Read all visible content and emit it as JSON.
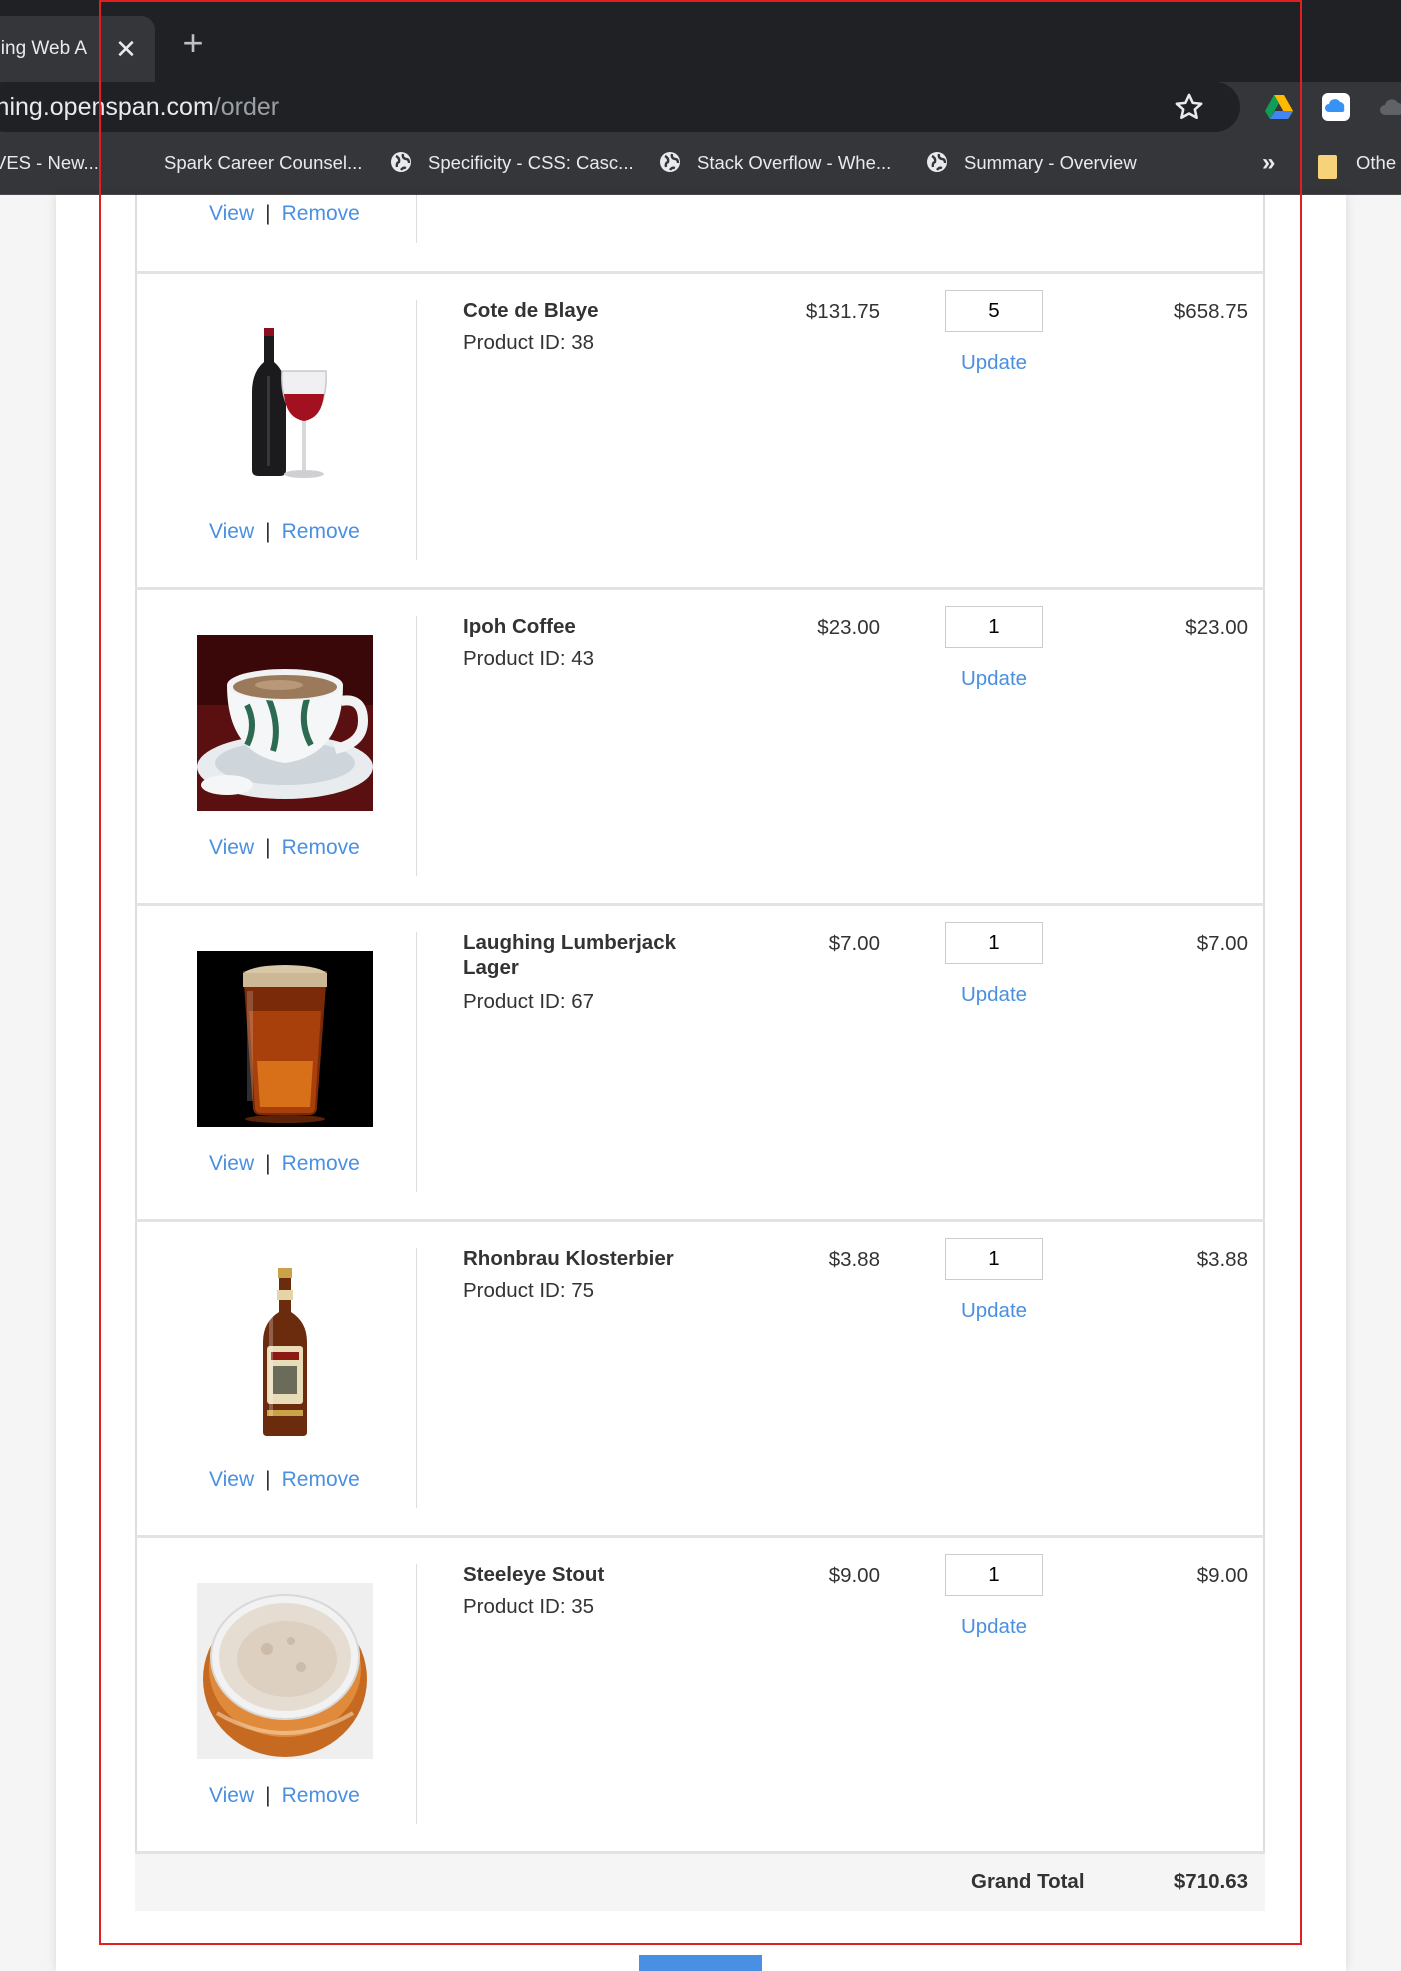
{
  "browser": {
    "tab_title": "ining Web A",
    "tab_close": "✕",
    "new_tab": "+",
    "url_host": "ining.openspan.com",
    "url_path": "/order",
    "bookmarks": [
      {
        "label": "VES - New..."
      },
      {
        "label": "Spark Career Counsel..."
      },
      {
        "label": "Specificity - CSS: Casc..."
      },
      {
        "label": "Stack Overflow - Whe..."
      },
      {
        "label": "Summary - Overview"
      }
    ],
    "bookmarks_more": "»",
    "other_bookmarks": "Othe"
  },
  "cart": {
    "view_label": "View",
    "remove_label": "Remove",
    "separator": "|",
    "update_label": "Update",
    "items": [
      {
        "name": "Cote de Blaye",
        "product_id": "Product ID: 38",
        "price": "$131.75",
        "quantity": "5",
        "total": "$658.75",
        "image": "red-wine-bottle-and-glass"
      },
      {
        "name": "Ipoh Coffee",
        "product_id": "Product ID: 43",
        "price": "$23.00",
        "quantity": "1",
        "total": "$23.00",
        "image": "coffee-cup-on-saucer"
      },
      {
        "name": "Laughing Lumberjack Lager",
        "product_id": "Product ID: 67",
        "price": "$7.00",
        "quantity": "1",
        "total": "$7.00",
        "image": "glass-of-lager"
      },
      {
        "name": "Rhonbrau Klosterbier",
        "product_id": "Product ID: 75",
        "price": "$3.88",
        "quantity": "1",
        "total": "$3.88",
        "image": "beer-bottle"
      },
      {
        "name": "Steeleye Stout",
        "product_id": "Product ID: 35",
        "price": "$9.00",
        "quantity": "1",
        "total": "$9.00",
        "image": "glass-of-stout-top-view"
      }
    ],
    "grand_total_label": "Grand Total",
    "grand_total_value": "$710.63"
  },
  "colors": {
    "link": "#4a90e2",
    "selection_outline": "#e02020",
    "chrome_dark": "#202124",
    "chrome_toolbar": "#35363a"
  }
}
